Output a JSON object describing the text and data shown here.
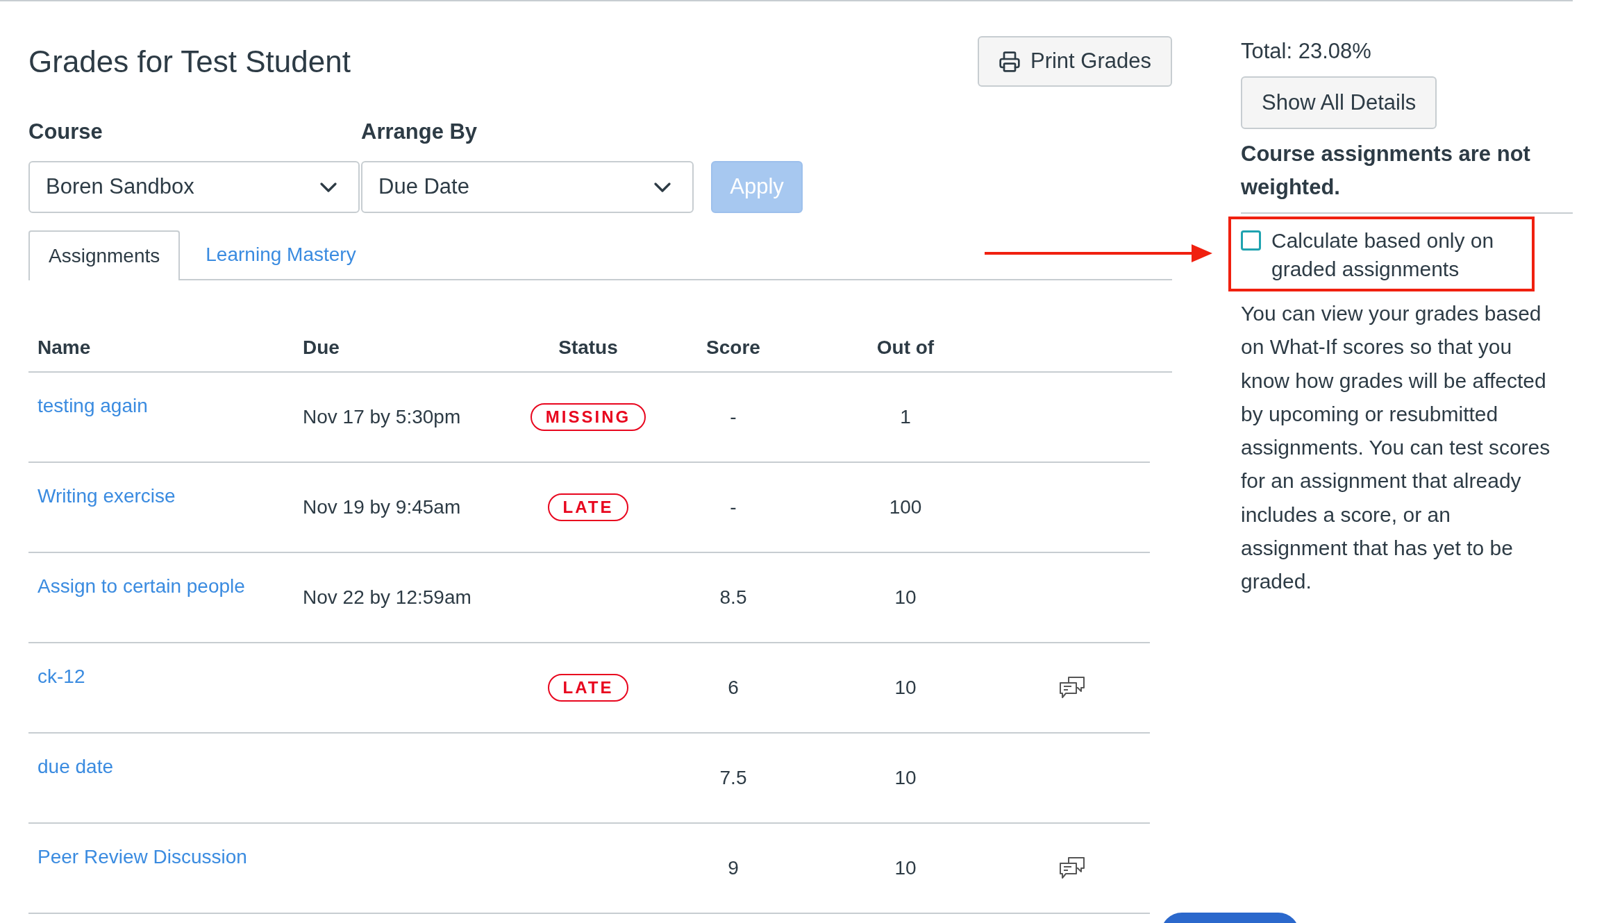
{
  "page": {
    "title": "Grades for Test Student",
    "print_button": "Print Grades"
  },
  "filters": {
    "course": {
      "label": "Course",
      "value": "Boren Sandbox"
    },
    "arrange_by": {
      "label": "Arrange By",
      "value": "Due Date"
    },
    "apply_button": {
      "label": "Apply",
      "disabled": true
    }
  },
  "tabs": [
    {
      "label": "Assignments",
      "selected": true
    },
    {
      "label": "Learning Mastery",
      "selected": false
    }
  ],
  "table": {
    "columns": [
      "Name",
      "Due",
      "Status",
      "Score",
      "Out of"
    ],
    "rows": [
      {
        "name": "testing again",
        "due": "Nov 17 by 5:30pm",
        "status": "MISSING",
        "score": "-",
        "out_of": "1",
        "comments": false
      },
      {
        "name": "Writing exercise",
        "due": "Nov 19 by 9:45am",
        "status": "LATE",
        "score": "-",
        "out_of": "100",
        "comments": false
      },
      {
        "name": "Assign to certain people",
        "due": "Nov 22 by 12:59am",
        "score": "8.5",
        "out_of": "10",
        "comments": false
      },
      {
        "name": "ck-12",
        "status": "LATE",
        "score": "6",
        "out_of": "10",
        "comments": true
      },
      {
        "name": "due date",
        "score": "7.5",
        "out_of": "10",
        "comments": false
      },
      {
        "name": "Peer Review Discussion",
        "score": "9",
        "out_of": "10",
        "comments": true
      }
    ]
  },
  "sidebar": {
    "total": "Total: 23.08%",
    "show_details_button": "Show All Details",
    "weight_note": "Course assignments are not weighted.",
    "graded_only": {
      "label": "Calculate based only on graded assignments",
      "checked": false,
      "highlighted": true
    },
    "what_if_note": "You can view your grades based on What-If scores so that you know how grades will be affected by upcoming or resubmitted assignments. You can test scores for an assignment that already includes a score, or an assignment that has yet to be graded."
  }
}
